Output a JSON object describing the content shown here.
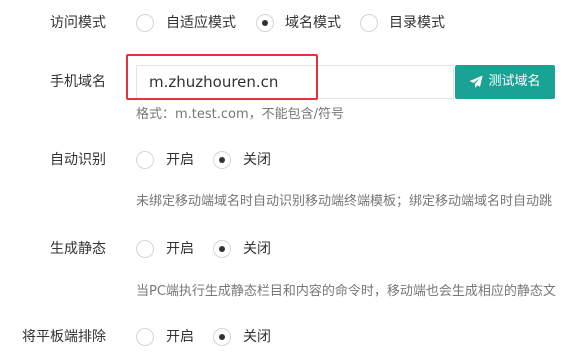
{
  "access_mode": {
    "label": "访问模式",
    "options": [
      "自适应模式",
      "域名模式",
      "目录模式"
    ],
    "selected_index": 1
  },
  "mobile_domain": {
    "label": "手机域名",
    "value": "m.zhuzhouren.cn",
    "test_button": "测试域名",
    "hint": "格式：m.test.com，不能包含/符号"
  },
  "auto_detect": {
    "label": "自动识别",
    "options": [
      "开启",
      "关闭"
    ],
    "selected_index": 1,
    "hint": "未绑定移动端域名时自动识别移动端终端模板；绑定移动端域名时自动跳"
  },
  "generate_static": {
    "label": "生成静态",
    "options": [
      "开启",
      "关闭"
    ],
    "selected_index": 1,
    "hint": "当PC端执行生成静态栏目和内容的命令时，移动端也会生成相应的静态文"
  },
  "exclude_tablet": {
    "label": "将平板端排除",
    "options": [
      "开启",
      "关闭"
    ],
    "selected_index": 1
  },
  "colors": {
    "accent": "#1aa394",
    "highlight": "#e0353b"
  },
  "icons": {
    "test_button_icon": "paper-plane-icon"
  }
}
